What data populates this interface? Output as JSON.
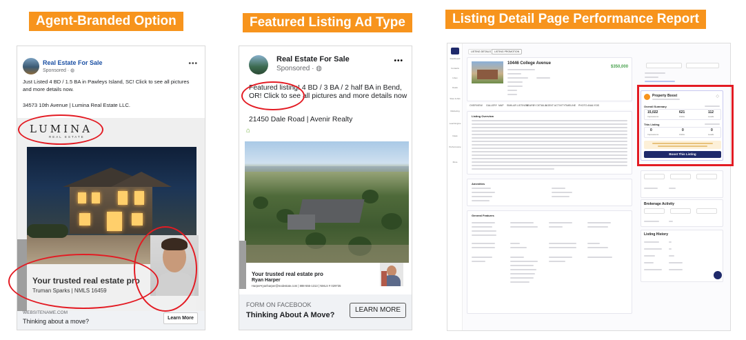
{
  "titles": {
    "agent": "Agent-Branded Option",
    "featured": "Featured Listing Ad Type",
    "report": "Listing Detail Page Performance Report"
  },
  "colors": {
    "orange": "#f7941d",
    "red": "#e31b23",
    "navy": "#1f2a6b"
  },
  "ad1": {
    "page_name": "Real Estate For Sale",
    "sponsored": "Sponsored · ",
    "body": "Just Listed 4 BD / 1.5 BA in Pawleys Island, SC! Click to see all pictures and more details now.",
    "address": "34573 10th Avenue | Lumina Real Estate LLC.",
    "logo_main": "LUMINA",
    "logo_sub": "REAL ESTATE",
    "agent_title": "Your trusted real estate pro",
    "agent_name": "Truman Sparks  |  NMLS 16459",
    "site": "WEBSITENAME.COM",
    "cta_question": "Thinking about a move?",
    "cta_button": "Learn More"
  },
  "ad2": {
    "page_name": "Real Estate For Sale",
    "sponsored": "Sponsored · ",
    "body": "Featured listing! 4 BD / 3 BA / 2 half BA in Bend, OR! Click to see all pictures and more details now",
    "address": "21450 Dale Road | Avenir Realty",
    "agent_title": "Your trusted real estate pro",
    "agent_name": "Ryan Harper",
    "agent_contact": "Harper•ryanharper@realestate.com | 888-555-1313 | NMLS # 029735",
    "form_label": "FORM ON FACEBOOK",
    "cta_question": "Thinking About A Move?",
    "cta_button": "LEARN MORE"
  },
  "report": {
    "tabs": [
      "LISTING DETAILS",
      "LISTING PROMOTION"
    ],
    "address": "10446 College Avenue",
    "price": "$350,000",
    "side_nav": [
      "Dashboard",
      "Contacts",
      "Inbox",
      "Deals",
      "Sites & Ads",
      "Marketing",
      "Lead Engine",
      "Ideas",
      "Performance",
      "More"
    ],
    "content_tabs": [
      "OVERVIEW",
      "GALLERY",
      "MAP",
      "SIMILAR LISTINGS",
      "NEARBY DETAILS",
      "AGENT ACTIVITY",
      "TIMELINE",
      "PHOTO ANALYSIS"
    ],
    "section_overview": "Listing Overview",
    "section_amenities": "Amenities",
    "section_features": "General Features",
    "boost": {
      "title": "Property Boost",
      "overall": "Overall Summary",
      "overall_stats": [
        {
          "value": "15,022",
          "label": "Impressions"
        },
        {
          "value": "621",
          "label": "Clicks"
        },
        {
          "value": "112",
          "label": "Leads"
        }
      ],
      "this_listing": "This Listing",
      "listing_stats": [
        {
          "value": "0",
          "label": "Impressions"
        },
        {
          "value": "0",
          "label": "Clicks"
        },
        {
          "value": "0",
          "label": "Leads"
        }
      ],
      "button": "Boost This Listing"
    },
    "brokerage": "Brokerage Activity",
    "history": "Listing History"
  }
}
